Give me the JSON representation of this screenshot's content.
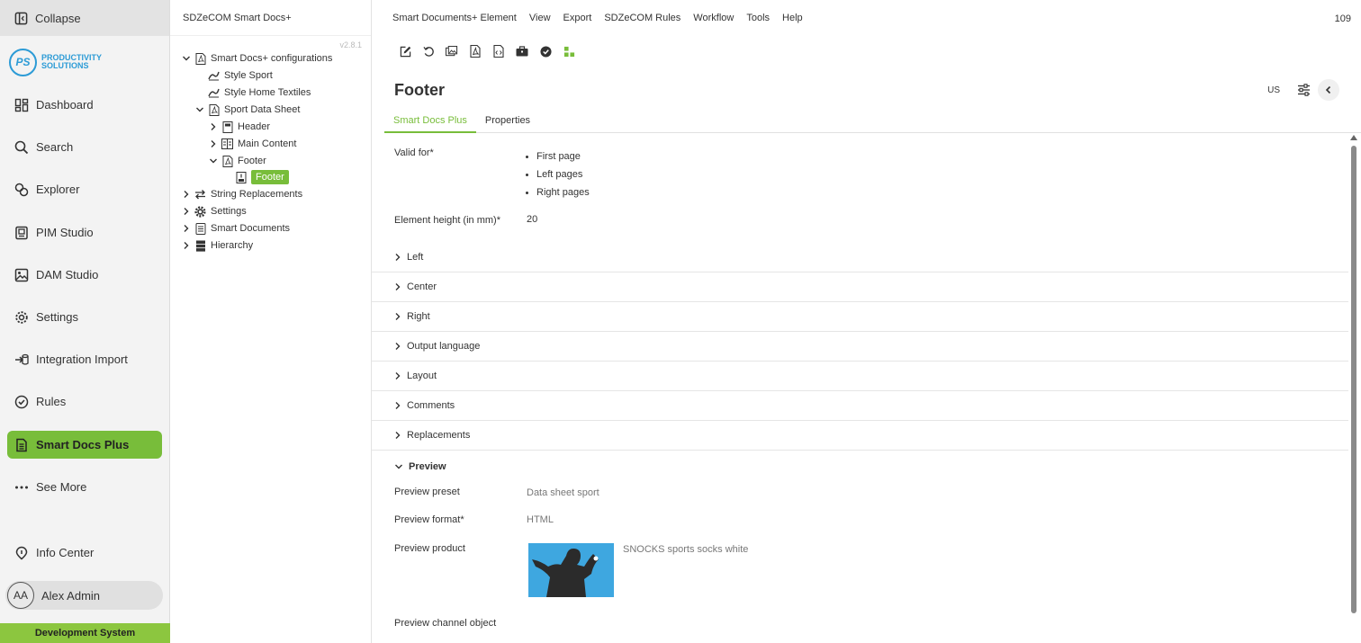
{
  "nav": {
    "collapse_label": "Collapse",
    "logo": {
      "initials": "PS",
      "line1": "PRODUCTIVITY",
      "line2": "SOLUTIONS"
    },
    "items": [
      {
        "label": "Dashboard",
        "icon": "dashboard-icon"
      },
      {
        "label": "Search",
        "icon": "search-icon"
      },
      {
        "label": "Explorer",
        "icon": "explorer-icon"
      },
      {
        "label": "PIM Studio",
        "icon": "pim-studio-icon"
      },
      {
        "label": "DAM Studio",
        "icon": "image-icon"
      },
      {
        "label": "Settings",
        "icon": "gear-icon"
      },
      {
        "label": "Integration Import",
        "icon": "import-icon"
      },
      {
        "label": "Rules",
        "icon": "check-circle-icon"
      },
      {
        "label": "Smart Docs Plus",
        "icon": "document-icon",
        "active": true
      },
      {
        "label": "See More",
        "icon": "more-icon"
      },
      {
        "label": "Info Center",
        "icon": "info-icon"
      }
    ],
    "user": {
      "initials": "AA",
      "name": "Alex Admin"
    },
    "environment": "Development System",
    "accent_color": "#78bd3a"
  },
  "tree": {
    "header": "SDZeCOM Smart Docs+",
    "version": "v2.8.1",
    "nodes": [
      {
        "label": "Smart Docs+ configurations"
      },
      {
        "label": "Style Sport"
      },
      {
        "label": "Style Home Textiles"
      },
      {
        "label": "Sport Data Sheet"
      },
      {
        "label": "Header"
      },
      {
        "label": "Main Content"
      },
      {
        "label": "Footer"
      },
      {
        "label": "Footer",
        "selected": true
      },
      {
        "label": "String Replacements"
      },
      {
        "label": "Settings"
      },
      {
        "label": "Smart Documents"
      },
      {
        "label": "Hierarchy"
      }
    ]
  },
  "main": {
    "menu": [
      "Smart Documents+ Element",
      "View",
      "Export",
      "SDZeCOM Rules",
      "Workflow",
      "Tools",
      "Help"
    ],
    "page_number": "109",
    "title": "Footer",
    "locale": "US",
    "tabs": [
      {
        "label": "Smart Docs Plus",
        "active": true
      },
      {
        "label": "Properties"
      }
    ],
    "valid_for": {
      "label": "Valid for*",
      "values": [
        "First page",
        "Left pages",
        "Right pages"
      ]
    },
    "element_height": {
      "label": "Element height (in mm)*",
      "value": "20"
    },
    "sections": [
      "Left",
      "Center",
      "Right",
      "Output language",
      "Layout",
      "Comments",
      "Replacements"
    ],
    "preview": {
      "label": "Preview",
      "preset_label": "Preview preset",
      "preset_value": "Data sheet sport",
      "format_label": "Preview format*",
      "format_value": "HTML",
      "product_label": "Preview product",
      "product_value": "SNOCKS sports socks white",
      "channel_label": "Preview channel object"
    }
  }
}
